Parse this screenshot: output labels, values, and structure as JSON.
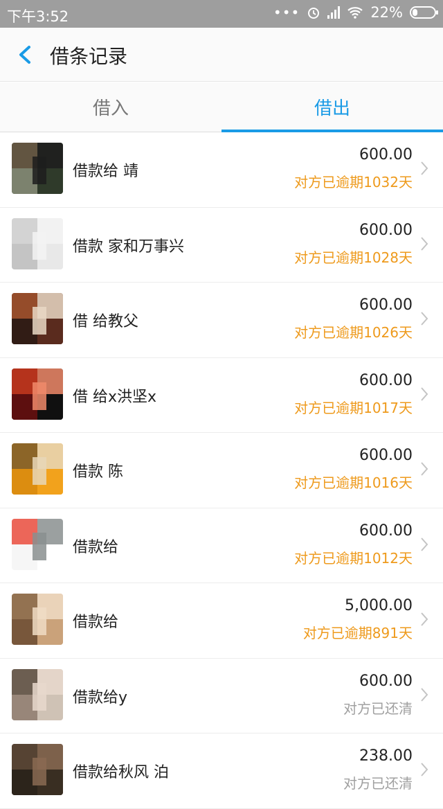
{
  "statusbar": {
    "time": "下午3:52",
    "battery": "22%",
    "battery_level": 0.22
  },
  "header": {
    "title": "借条记录"
  },
  "tabs": [
    {
      "label": "借入",
      "active": false
    },
    {
      "label": "借出",
      "active": true
    }
  ],
  "colors": {
    "accent": "#1a9be6",
    "overdue": "#ee9a1c",
    "settled": "#a0a0a0"
  },
  "records": [
    {
      "name": "借款给 靖",
      "amount": "600.00",
      "status": "对方已逾期1032天",
      "state": "overdue"
    },
    {
      "name": "借款 家和万事兴",
      "amount": "600.00",
      "status": "对方已逾期1028天",
      "state": "overdue"
    },
    {
      "name": "借 给教父",
      "amount": "600.00",
      "status": "对方已逾期1026天",
      "state": "overdue"
    },
    {
      "name": "借 给x洪坚x",
      "amount": "600.00",
      "status": "对方已逾期1017天",
      "state": "overdue"
    },
    {
      "name": "借款 陈",
      "amount": "600.00",
      "status": "对方已逾期1016天",
      "state": "overdue"
    },
    {
      "name": "借款给",
      "amount": "600.00",
      "status": "对方已逾期1012天",
      "state": "overdue"
    },
    {
      "name": "借款给 ",
      "amount": "5,000.00",
      "status": "对方已逾期891天",
      "state": "overdue"
    },
    {
      "name": "借款给y",
      "amount": "600.00",
      "status": "对方已还清",
      "state": "settled"
    },
    {
      "name": "借款给秋风 泊",
      "amount": "238.00",
      "status": "对方已还清",
      "state": "settled"
    }
  ]
}
